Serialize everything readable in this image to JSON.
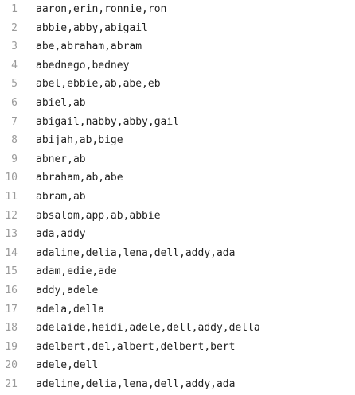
{
  "file_viewer": {
    "lines": [
      {
        "number": "1",
        "text": "aaron,erin,ronnie,ron"
      },
      {
        "number": "2",
        "text": "abbie,abby,abigail"
      },
      {
        "number": "3",
        "text": "abe,abraham,abram"
      },
      {
        "number": "4",
        "text": "abednego,bedney"
      },
      {
        "number": "5",
        "text": "abel,ebbie,ab,abe,eb"
      },
      {
        "number": "6",
        "text": "abiel,ab"
      },
      {
        "number": "7",
        "text": "abigail,nabby,abby,gail"
      },
      {
        "number": "8",
        "text": "abijah,ab,bige"
      },
      {
        "number": "9",
        "text": "abner,ab"
      },
      {
        "number": "10",
        "text": "abraham,ab,abe"
      },
      {
        "number": "11",
        "text": "abram,ab"
      },
      {
        "number": "12",
        "text": "absalom,app,ab,abbie"
      },
      {
        "number": "13",
        "text": "ada,addy"
      },
      {
        "number": "14",
        "text": "adaline,delia,lena,dell,addy,ada"
      },
      {
        "number": "15",
        "text": "adam,edie,ade"
      },
      {
        "number": "16",
        "text": "addy,adele"
      },
      {
        "number": "17",
        "text": "adela,della"
      },
      {
        "number": "18",
        "text": "adelaide,heidi,adele,dell,addy,della"
      },
      {
        "number": "19",
        "text": "adelbert,del,albert,delbert,bert"
      },
      {
        "number": "20",
        "text": "adele,dell"
      },
      {
        "number": "21",
        "text": "adeline,delia,lena,dell,addy,ada"
      }
    ]
  }
}
